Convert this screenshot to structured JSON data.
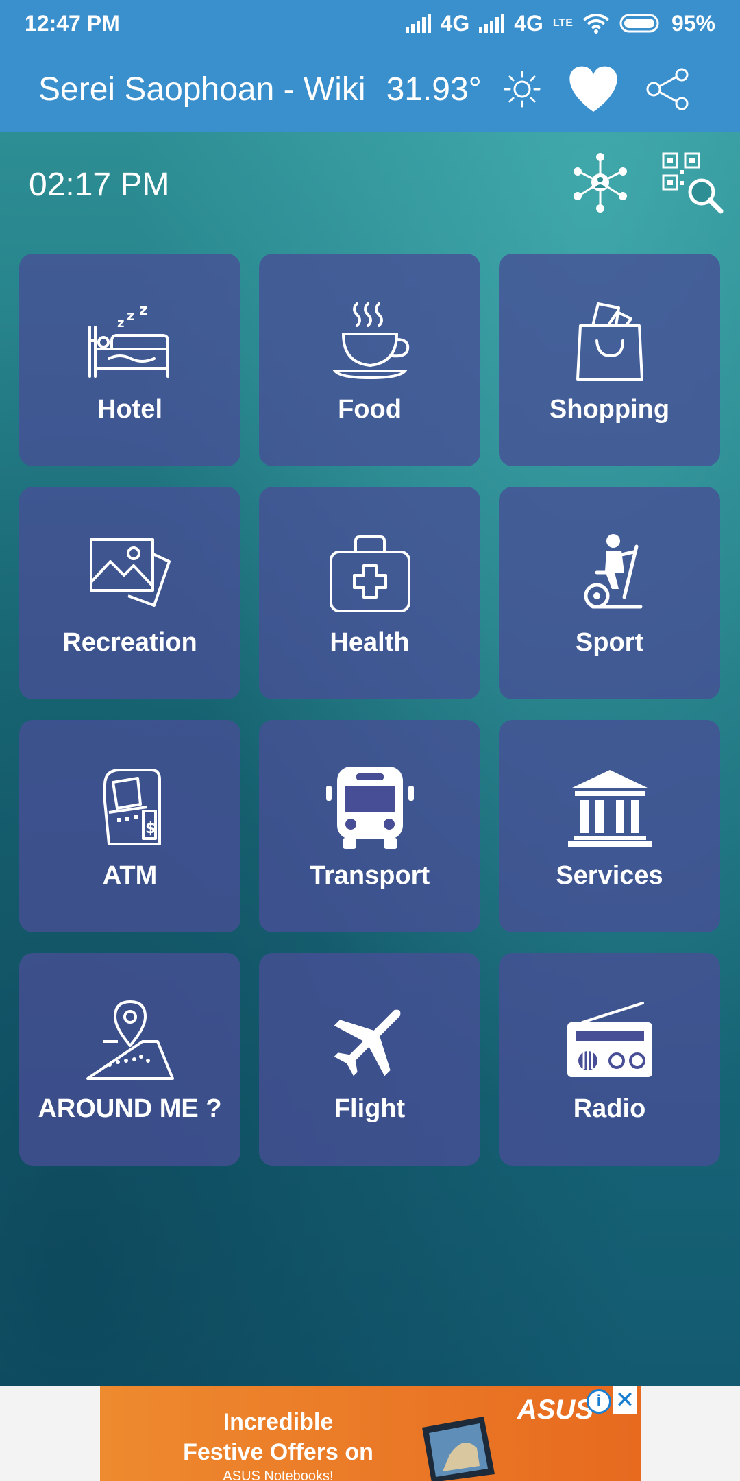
{
  "status_bar": {
    "time": "12:47 PM",
    "network1": "4G",
    "network2": "4G",
    "volte": "LTE",
    "battery": "95%"
  },
  "app_bar": {
    "title": "Serei Saophoan - Wiki",
    "temperature": "31.93°"
  },
  "content": {
    "clock": "02:17 PM"
  },
  "tiles": [
    {
      "label": "Hotel",
      "icon": "bed-icon"
    },
    {
      "label": "Food",
      "icon": "coffee-cup-icon"
    },
    {
      "label": "Shopping",
      "icon": "shopping-bag-icon"
    },
    {
      "label": "Recreation",
      "icon": "pictures-icon"
    },
    {
      "label": "Health",
      "icon": "first-aid-kit-icon"
    },
    {
      "label": "Sport",
      "icon": "exercise-bike-icon"
    },
    {
      "label": "ATM",
      "icon": "atm-machine-icon"
    },
    {
      "label": "Transport",
      "icon": "bus-icon"
    },
    {
      "label": "Services",
      "icon": "government-building-icon"
    },
    {
      "label": "AROUND ME ?",
      "icon": "map-pin-icon"
    },
    {
      "label": "Flight",
      "icon": "airplane-icon"
    },
    {
      "label": "Radio",
      "icon": "radio-icon"
    }
  ],
  "ad": {
    "line1": "Incredible",
    "line2": "Festive Offers on",
    "line3": "ASUS Notebooks!",
    "brand": "ASUS",
    "info": "i",
    "close": "✕"
  },
  "colors": {
    "app_bar": "#3a8fcd",
    "tile": "#484e96",
    "ad": "#e97d28"
  }
}
